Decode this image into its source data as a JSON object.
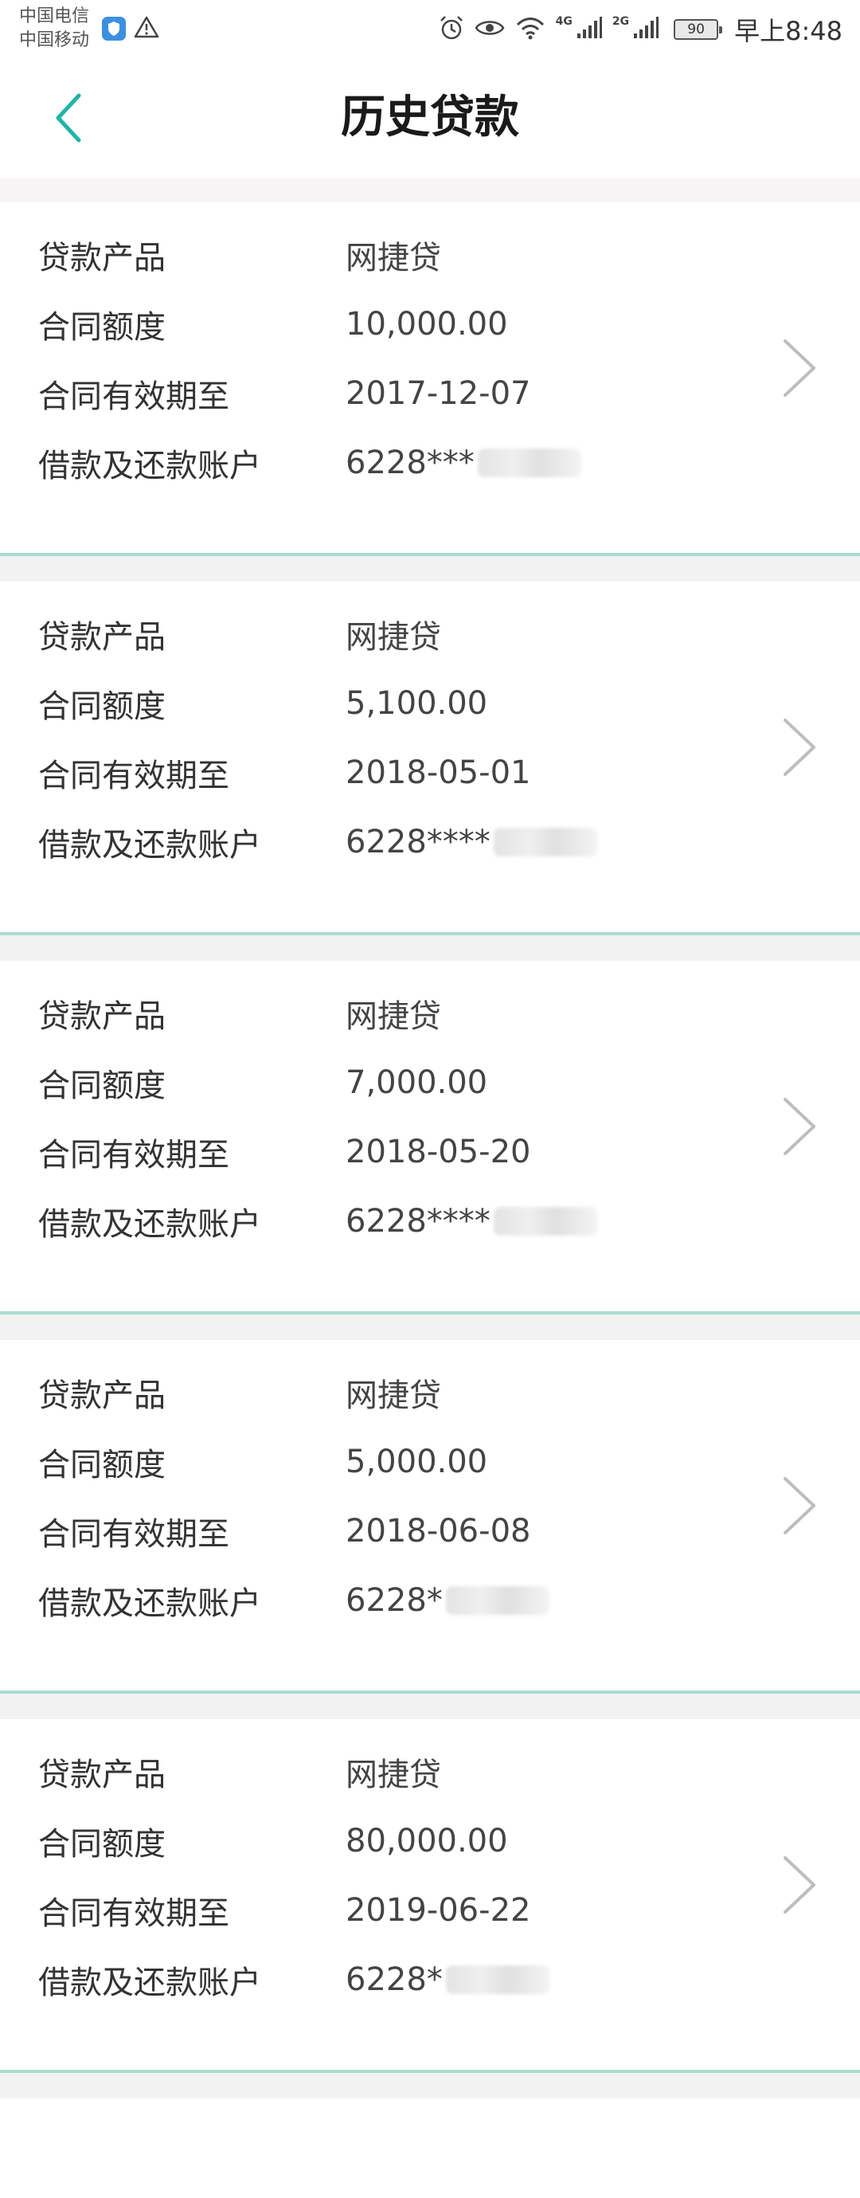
{
  "status_bar": {
    "carrier_1": "中国电信",
    "carrier_2": "中国移动",
    "network_1": "4G",
    "network_2": "2G",
    "battery": "90",
    "time": "早上8:48"
  },
  "header": {
    "title": "历史贷款",
    "back_icon": "chevron-left-icon",
    "accent_color": "#1fb5a8"
  },
  "loans": [
    {
      "product_label": "贷款产品",
      "product": "网捷贷",
      "amount_label": "合同额度",
      "amount": "10,000.00",
      "expiry_label": "合同有效期至",
      "expiry": "2017-12-07",
      "account_label": "借款及还款账户",
      "account": "6228***"
    },
    {
      "product_label": "贷款产品",
      "product": "网捷贷",
      "amount_label": "合同额度",
      "amount": "5,100.00",
      "expiry_label": "合同有效期至",
      "expiry": "2018-05-01",
      "account_label": "借款及还款账户",
      "account": "6228****"
    },
    {
      "product_label": "贷款产品",
      "product": "网捷贷",
      "amount_label": "合同额度",
      "amount": "7,000.00",
      "expiry_label": "合同有效期至",
      "expiry": "2018-05-20",
      "account_label": "借款及还款账户",
      "account": "6228****"
    },
    {
      "product_label": "贷款产品",
      "product": "网捷贷",
      "amount_label": "合同额度",
      "amount": "5,000.00",
      "expiry_label": "合同有效期至",
      "expiry": "2018-06-08",
      "account_label": "借款及还款账户",
      "account": "6228*"
    },
    {
      "product_label": "贷款产品",
      "product": "网捷贷",
      "amount_label": "合同额度",
      "amount": "80,000.00",
      "expiry_label": "合同有效期至",
      "expiry": "2019-06-22",
      "account_label": "借款及还款账户",
      "account": "6228*"
    }
  ]
}
